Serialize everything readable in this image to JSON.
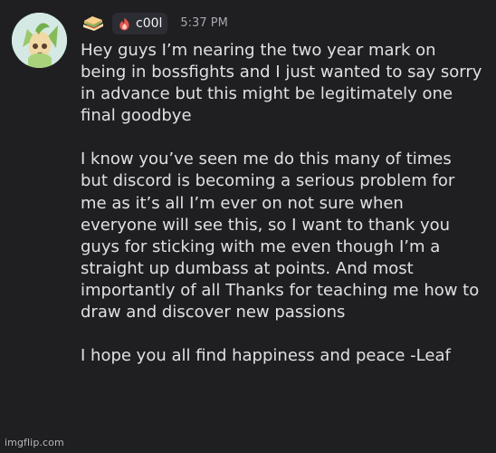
{
  "message": {
    "author_name": "c00l",
    "timestamp": "5:37 PM",
    "avatar_icon": "leafeon-avatar",
    "badge_icon": "sandwich-icon",
    "tag_icon": "flame-icon",
    "paragraphs": [
      "Hey guys I’m nearing the two year mark on being in bossfights and I just wanted to say sorry in advance but this might be legitimately one final goodbye",
      "I know you’ve seen me do this many of times but discord is becoming a serious problem for me as it’s all I’m ever on not sure when everyone will see this, so I want to thank you guys for sticking with me even though I’m a straight up dumbass at points. And most importantly of all Thanks for teaching me how to draw and discover new passions",
      "I hope you all find happiness and peace -Leaf"
    ]
  },
  "watermark": "imgflip.com",
  "colors": {
    "background": "#1f1f22",
    "text": "#dfe0e4",
    "timestamp": "#a4a7ae",
    "tag_background": "#2c2d32",
    "flame": "#e8564f"
  }
}
